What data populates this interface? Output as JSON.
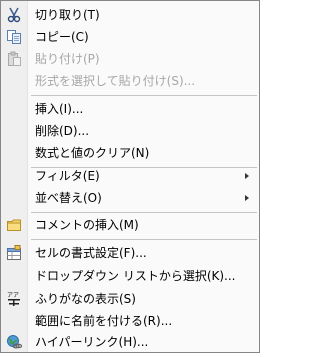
{
  "menu": {
    "cut": "切り取り(T)",
    "copy": "コピー(C)",
    "paste": "貼り付け(P)",
    "paste_special": "形式を選択して貼り付け(S)...",
    "insert": "挿入(I)...",
    "delete": "削除(D)...",
    "clear_contents": "数式と値のクリア(N)",
    "filter": "フィルタ(E)",
    "sort": "並べ替え(O)",
    "insert_comment": "コメントの挿入(M)",
    "format_cells": "セルの書式設定(F)...",
    "pick_from_list": "ドロップダウン リストから選択(K)...",
    "show_phonetic": "ふりがなの表示(S)",
    "name_range": "範囲に名前を付ける(R)...",
    "hyperlink": "ハイパーリンク(H)..."
  },
  "colors": {
    "border": "#868686",
    "gutter": "#efefef",
    "disabled_text": "#a7a7a7",
    "separator": "#c5c5c5"
  },
  "icons": {
    "cut": "scissors-icon",
    "copy": "copy-icon",
    "paste": "paste-icon",
    "comment": "comment-icon",
    "format": "format-cells-icon",
    "phonetic": "phonetic-icon",
    "hyperlink": "hyperlink-icon"
  }
}
